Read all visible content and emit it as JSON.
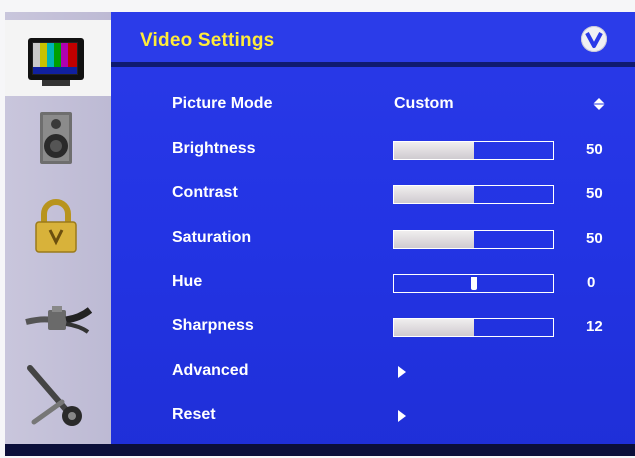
{
  "header": {
    "title": "Video Settings",
    "logo_icon": "vizio-v-logo-icon"
  },
  "sidebar": {
    "items": [
      {
        "id": "video",
        "icon": "tv-color-bars-icon",
        "active": true
      },
      {
        "id": "audio",
        "icon": "speaker-icon",
        "active": false
      },
      {
        "id": "parental",
        "icon": "padlock-icon",
        "active": false
      },
      {
        "id": "input",
        "icon": "cable-connector-icon",
        "active": false
      },
      {
        "id": "setup",
        "icon": "wrench-tools-icon",
        "active": false
      }
    ]
  },
  "settings": {
    "picture_mode": {
      "label": "Picture Mode",
      "value": "Custom",
      "icon": "up-down-diamond-icon"
    },
    "brightness": {
      "label": "Brightness",
      "value": "50",
      "fraction": 0.5
    },
    "contrast": {
      "label": "Contrast",
      "value": "50",
      "fraction": 0.5
    },
    "saturation": {
      "label": "Saturation",
      "value": "50",
      "fraction": 0.5
    },
    "hue": {
      "label": "Hue",
      "value": "0",
      "fraction": 0.5
    },
    "sharpness": {
      "label": "Sharpness",
      "value": "12",
      "fraction": 0.5
    },
    "advanced": {
      "label": "Advanced",
      "icon": "right-arrow-icon"
    },
    "reset": {
      "label": "Reset",
      "icon": "right-arrow-icon"
    }
  },
  "colors": {
    "title": "#ffec3a",
    "panel": "#2334e4",
    "sidebar": "#bdbad4"
  }
}
